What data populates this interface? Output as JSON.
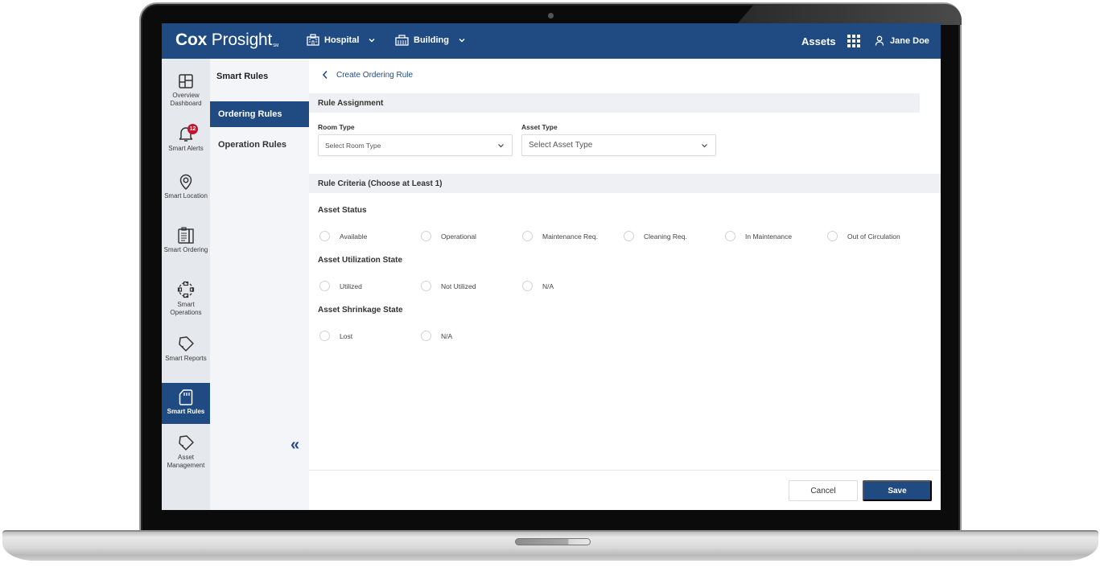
{
  "app": {
    "brand_bold": "Cox",
    "brand_light": "Prosight",
    "brand_mark": "SM",
    "header": {
      "hospital_label": "Hospital",
      "building_label": "Building",
      "assets_label": "Assets",
      "user_name": "Jane Doe"
    },
    "colors": {
      "primary": "#1f4b82",
      "badge": "#c8102e"
    }
  },
  "rail": {
    "items": [
      {
        "label": "Overview Dashboard",
        "icon": "dashboard-icon"
      },
      {
        "label": "Smart Alerts",
        "icon": "bell-icon",
        "badge": "12"
      },
      {
        "label": "Smart Location",
        "icon": "location-pin-icon"
      },
      {
        "label": "Smart Ordering",
        "icon": "clipboard-icon"
      },
      {
        "label": "Smart Operations",
        "icon": "operations-cycle-icon"
      },
      {
        "label": "Smart Reports",
        "icon": "tag-icon"
      },
      {
        "label": "Smart Rules",
        "icon": "sd-card-icon",
        "active": true
      },
      {
        "label": "Asset Management",
        "icon": "tag-icon"
      }
    ]
  },
  "subnav": {
    "title": "Smart Rules",
    "items": [
      {
        "label": "Ordering Rules",
        "active": true
      },
      {
        "label": "Operation Rules"
      }
    ],
    "collapse_glyph": "«"
  },
  "main": {
    "back_label": "Create Ordering Rule",
    "rule_assignment": {
      "title": "Rule Assignment",
      "room_type_label": "Room Type",
      "room_type_placeholder": "Select Room Type",
      "asset_type_label": "Asset Type",
      "asset_type_placeholder": "Select Asset Type"
    },
    "criteria": {
      "title": "Rule Criteria (Choose at Least 1)",
      "groups": [
        {
          "title": "Asset Status",
          "options": [
            "Available",
            "Operational",
            "Maintenance Req.",
            "Cleaning Req.",
            "In Maintenance",
            "Out of Circulation"
          ]
        },
        {
          "title": "Asset Utilization State",
          "options": [
            "Utilized",
            "Not Utilized",
            "N/A"
          ]
        },
        {
          "title": "Asset Shrinkage State",
          "options": [
            "Lost",
            "N/A"
          ]
        }
      ]
    },
    "footer": {
      "cancel_label": "Cancel",
      "save_label": "Save"
    }
  }
}
